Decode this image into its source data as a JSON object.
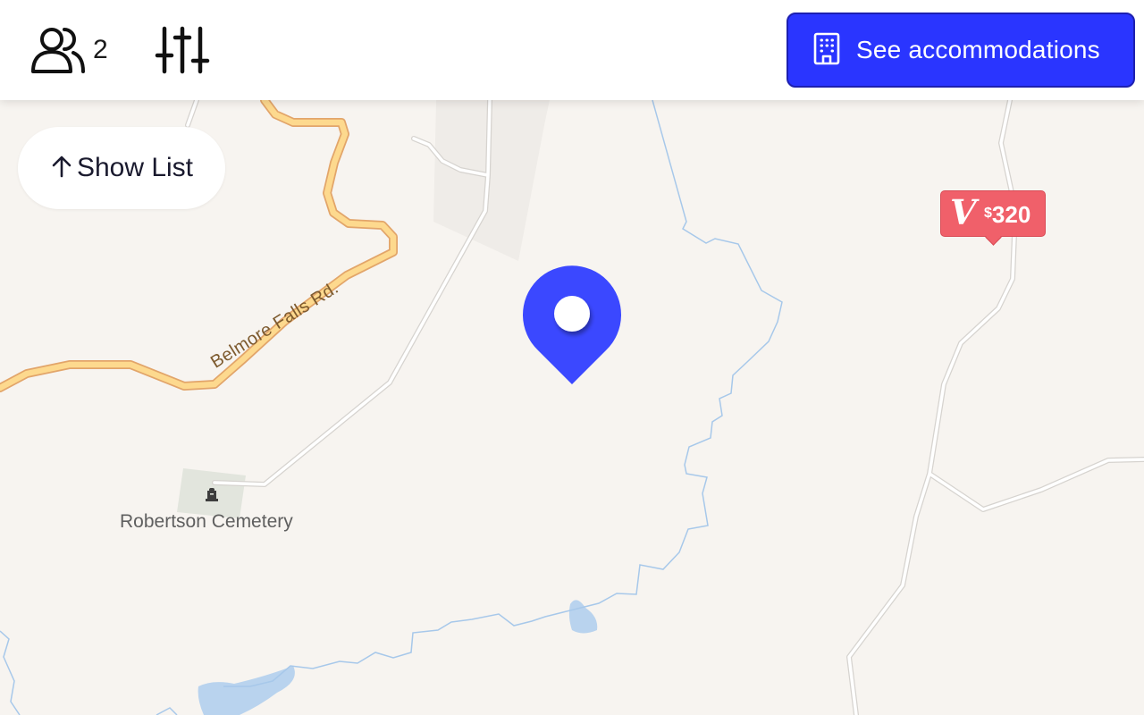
{
  "header": {
    "guests": {
      "icon": "users-icon",
      "count": "2"
    },
    "filters": {
      "icon": "sliders-icon"
    },
    "cta": {
      "icon": "building-icon",
      "label": "See accommodations",
      "color": "#2a35ff"
    }
  },
  "show_list": {
    "icon": "arrow-up-icon",
    "label": "Show List"
  },
  "map": {
    "road_label": "Belmore Falls Rd.",
    "place_label": "Robertson Cemetery",
    "place_icon": "cemetery-icon",
    "location_pin": {
      "icon": "location-pin-icon",
      "color": "#3b48ff"
    },
    "price_marker": {
      "brand_icon": "V",
      "currency": "$",
      "price": "320",
      "color": "#f0606a"
    }
  }
}
